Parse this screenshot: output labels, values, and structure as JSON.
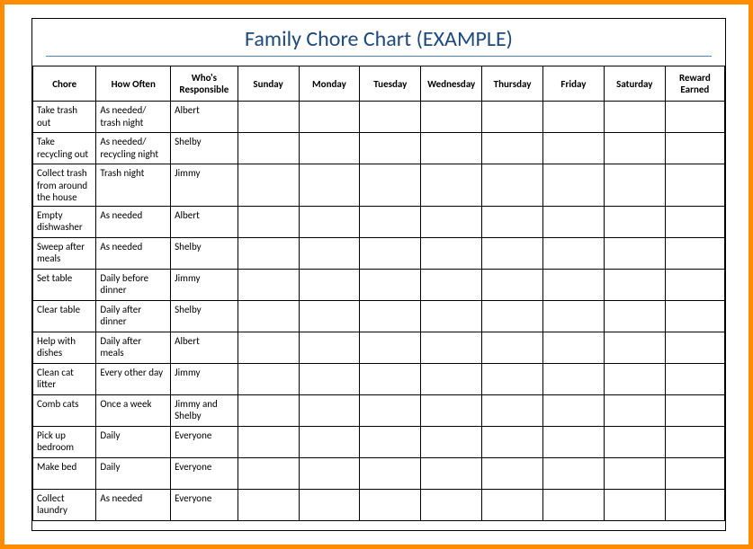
{
  "title": "Family Chore Chart (EXAMPLE)",
  "headers": [
    "Chore",
    "How Often",
    "Who's Responsible",
    "Sunday",
    "Monday",
    "Tuesday",
    "Wednesday",
    "Thursday",
    "Friday",
    "Saturday",
    "Reward Earned"
  ],
  "rows": [
    {
      "chore": "Take trash out",
      "often": "As needed/ trash night",
      "who": "Albert"
    },
    {
      "chore": "Take recycling out",
      "often": "As needed/ recycling night",
      "who": "Shelby"
    },
    {
      "chore": "Collect trash from around the house",
      "often": "Trash night",
      "who": "Jimmy"
    },
    {
      "chore": "Empty dishwasher",
      "often": "As needed",
      "who": "Albert"
    },
    {
      "chore": "Sweep after meals",
      "often": "As needed",
      "who": "Shelby"
    },
    {
      "chore": "Set table",
      "often": "Daily before dinner",
      "who": "Jimmy"
    },
    {
      "chore": "Clear table",
      "often": "Daily after dinner",
      "who": "Shelby"
    },
    {
      "chore": "Help with dishes",
      "often": "Daily after meals",
      "who": "Albert"
    },
    {
      "chore": "Clean cat litter",
      "often": "Every other day",
      "who": "Jimmy"
    },
    {
      "chore": "Comb cats",
      "often": "Once a week",
      "who": "Jimmy and Shelby"
    },
    {
      "chore": "Pick up bedroom",
      "often": "Daily",
      "who": "Everyone"
    },
    {
      "chore": "Make bed",
      "often": "Daily",
      "who": "Everyone"
    },
    {
      "chore": "Collect laundry",
      "often": "As needed",
      "who": "Everyone"
    }
  ]
}
